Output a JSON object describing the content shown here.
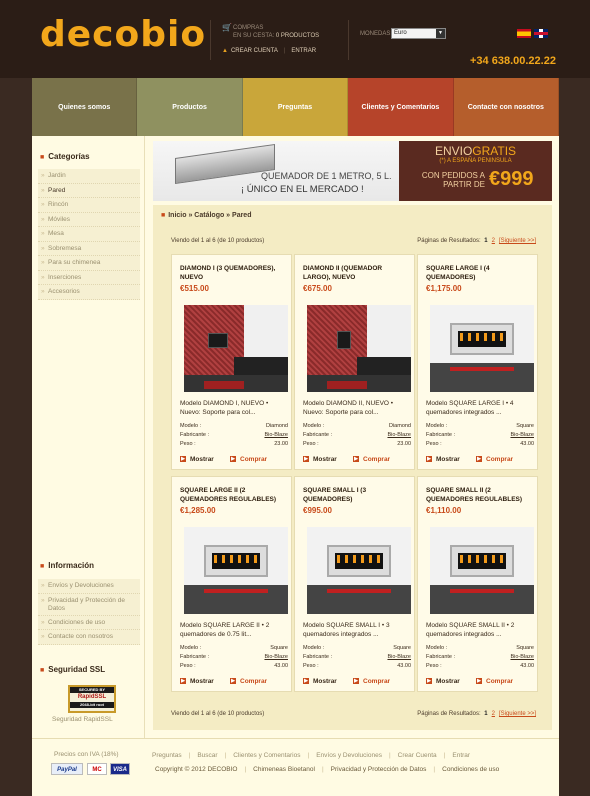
{
  "header": {
    "logo": "decobio",
    "cart_line1": "COMPRAS",
    "cart_line2_prefix": "EN SU CESTA:",
    "cart_line2_value": "0 PRODUCTOS",
    "create_account": "CREAR CUENTA",
    "login": "ENTRAR",
    "currency_label": "MONEDAS:",
    "currency_value": "Euro",
    "phone": "+34 638.00.22.22"
  },
  "nav": [
    "Quienes somos",
    "Productos",
    "Preguntas",
    "Clientes y Comentarios",
    "Contacte con nosotros"
  ],
  "sidebar": {
    "categories_title": "Categorías",
    "categories": [
      "Jardin",
      "Pared",
      "Rincón",
      "Móviles",
      "Mesa",
      "Sobremesa",
      "Para su chimenea",
      "Inserciones",
      "Accesorios"
    ],
    "info_title": "Información",
    "info": [
      "Envíos y Devoluciones",
      "Privacidad y Protección de Datos",
      "Condiciones de uso",
      "Contacte con nosotros"
    ],
    "ssl_title": "Seguridad SSL",
    "ssl_badge_top": "SECURED BY",
    "ssl_badge_mid": "RapidSSL",
    "ssl_badge_bot": "2048-bit root",
    "ssl_caption": "Seguridad RapidSSL"
  },
  "banner": {
    "left_line1": "QUEMADOR DE 1 METRO, 5 L.",
    "left_line2": "¡ ÚNICO EN EL MERCADO !",
    "right_line1a": "ENVIO",
    "right_line1b": "GRATIS",
    "right_line2": "(*) A ESPAÑA PENINSULA",
    "right_line3": "CON PEDIDOS A PARTIR DE",
    "right_amount": "€999"
  },
  "content": {
    "breadcrumb": "Inicio » Catálogo » Pared",
    "showing": "Viendo del 1 al 6 (de 10 productos)",
    "results_label": "Páginas de Resultados:",
    "page_current": "1",
    "page_next": "2",
    "next_link": "[Siguiente >>]"
  },
  "labels": {
    "model": "Modelo :",
    "maker": "Fabricante :",
    "weight": "Peso :",
    "show": "Mostrar",
    "buy": "Comprar"
  },
  "products": [
    {
      "name": "DIAMOND I (3 QUEMADORES), NUEVO",
      "price": "€515.00",
      "desc": "Modelo DIAMOND I, NUEVO • Nuevo: Soporte para col...",
      "model": "Diamond",
      "maker": "Bio-Blaze",
      "weight": "23.00"
    },
    {
      "name": "DIAMOND II (QUEMADOR LARGO), NUEVO",
      "price": "€675.00",
      "desc": "Modelo DIAMOND II, NUEVO • Nuevo: Soporte para col...",
      "model": "Diamond",
      "maker": "Bio-Blaze",
      "weight": "23.00"
    },
    {
      "name": "SQUARE LARGE I (4 QUEMADORES)",
      "price": "€1,175.00",
      "desc": "Modelo SQUARE LARGE I • 4 quemadores integrados ...",
      "model": "Square",
      "maker": "Bio-Blaze",
      "weight": "43.00"
    },
    {
      "name": "SQUARE LARGE II (2 QUEMADORES REGULABLES)",
      "price": "€1,285.00",
      "desc": "Modelo SQUARE LARGE II • 2 quemadores de 0.75 lit...",
      "model": "Square",
      "maker": "Bio-Blaze",
      "weight": "43.00"
    },
    {
      "name": "SQUARE SMALL I (3 QUEMADORES)",
      "price": "€995.00",
      "desc": "Modelo SQUARE SMALL I • 3 quemadores integrados ...",
      "model": "Square",
      "maker": "Bio-Blaze",
      "weight": "43.00"
    },
    {
      "name": "SQUARE SMALL II (2 QUEMADORES REGULABLES)",
      "price": "€1,110.00",
      "desc": "Modelo SQUARE SMALL II • 2 quemadores integrados ...",
      "model": "Square",
      "maker": "Bio-Blaze",
      "weight": "43.00"
    }
  ],
  "footer": {
    "tax_note": "Precios con IVA (18%)",
    "pay_paypal": "PayPal",
    "pay_mc": "MC",
    "pay_visa": "VISA",
    "links": [
      "Preguntas",
      "Buscar",
      "Clientes y Comentarios",
      "Envíos y Devoluciones",
      "Crear Cuenta",
      "Entrar"
    ],
    "copyright": "Copyright © 2012 DECOBIO",
    "copy_links": [
      "Chimeneas Bioetanol",
      "Privacidad y Protección de Datos",
      "Condiciones de uso"
    ]
  }
}
